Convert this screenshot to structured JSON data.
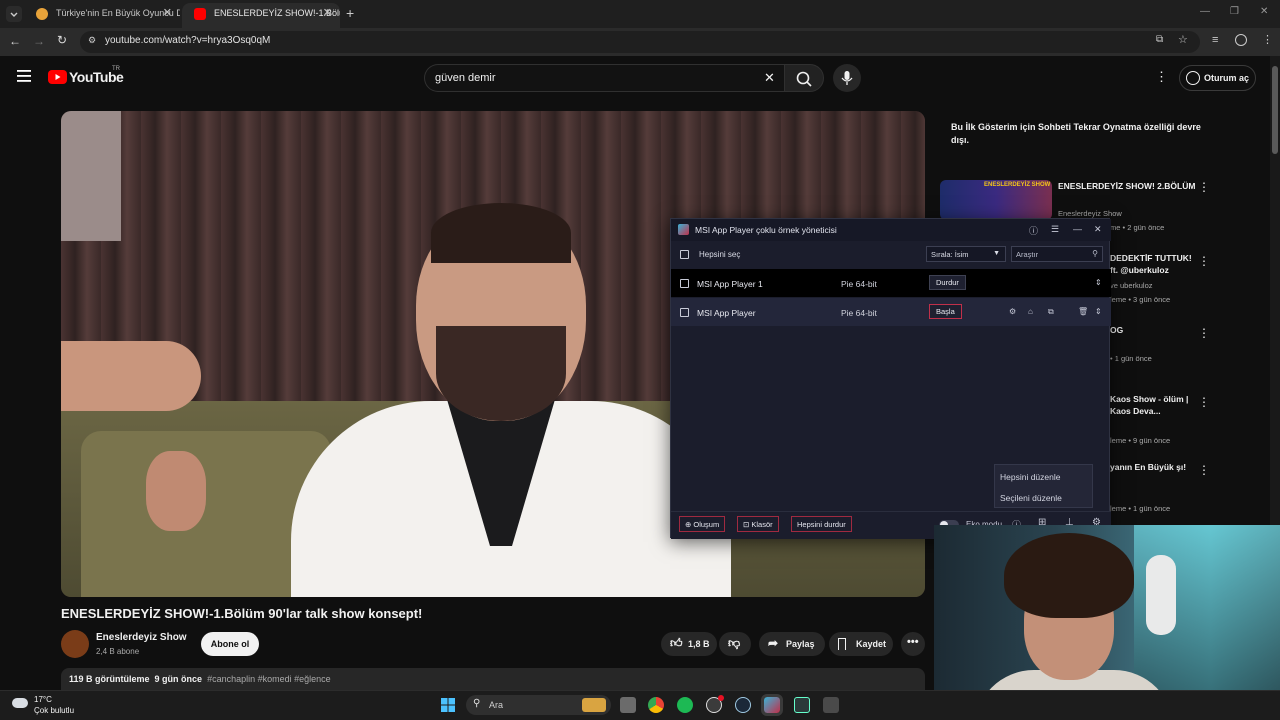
{
  "browser": {
    "tabs": [
      {
        "title": "Türkiye'nin En Büyük Oyuncu D",
        "active": false
      },
      {
        "title": "ENESLERDEYİZ SHOW!-1.Bölüm",
        "active": true
      }
    ],
    "url": "youtube.com/watch?v=hrya3Osq0qM"
  },
  "youtube": {
    "logo_text": "YouTube",
    "logo_region": "TR",
    "search_query": "güven demir",
    "signin_label": "Oturum aç",
    "video": {
      "title": "ENESLERDEYİZ SHOW!-1.Bölüm 90'lar talk show konsept!",
      "channel": "Eneslerdeyiz Show",
      "subscribers": "2,4 B abone",
      "subscribe_label": "Abone ol",
      "likes": "1,8 B",
      "share_label": "Paylaş",
      "save_label": "Kaydet",
      "views": "119 B görüntüleme",
      "date": "9 gün önce",
      "tags": "#canchaplin #komedi #eğlence"
    },
    "chat_notice": "Bu İlk Gösterim için Sohbeti Tekrar Oynatma özelliği devre dışı.",
    "recommendations": [
      {
        "title": "ENESLERDEYİZ SHOW! 2.BÖLÜM",
        "channel": "Eneslerdeyiz Show",
        "meta": "me • 2 gün önce",
        "thumb_text": "ENESLERDEYİZ SHOW"
      },
      {
        "title": "DEDEKTİF TUTTUK! ft. @uberkuloz",
        "channel": "ve uberkuloz",
        "meta": "leme • 3 gün önce",
        "thumb_text": ""
      },
      {
        "title": "OG",
        "channel": "",
        "meta": "• 1 gün önce",
        "thumb_text": ""
      },
      {
        "title": "Kaos Show - ölüm | Kaos Deva...",
        "channel": "",
        "meta": "leme • 9 gün önce",
        "thumb_text": ""
      },
      {
        "title": "yanın En Büyük şı!",
        "channel": "",
        "meta": "leme • 1 gün önce",
        "thumb_text": ""
      }
    ]
  },
  "msi": {
    "title": "MSI App Player çoklu örnek yöneticisi",
    "select_all": "Hepsini seç",
    "sort_label": "Sırala: İsim",
    "search_placeholder": "Araştır",
    "instances": [
      {
        "name": "MSI App Player 1",
        "arch": "Pie 64-bit",
        "action": "Durdur"
      },
      {
        "name": "MSI App Player",
        "arch": "Pie 64-bit",
        "action": "Başla"
      }
    ],
    "menu": {
      "edit_all": "Hepsini düzenle",
      "edit_selected": "Seçileni düzenle"
    },
    "footer": {
      "create": "Oluşum",
      "folder": "Klasör",
      "stop_all": "Hepsini durdur",
      "eco": "Eko modu"
    }
  },
  "taskbar": {
    "temperature": "17°C",
    "weather": "Çok bulutlu",
    "search_label": "Ara"
  },
  "colors": {
    "youtube_red": "#ff0000",
    "msi_accent": "#c0304a",
    "bg": "#0f0f0f"
  }
}
